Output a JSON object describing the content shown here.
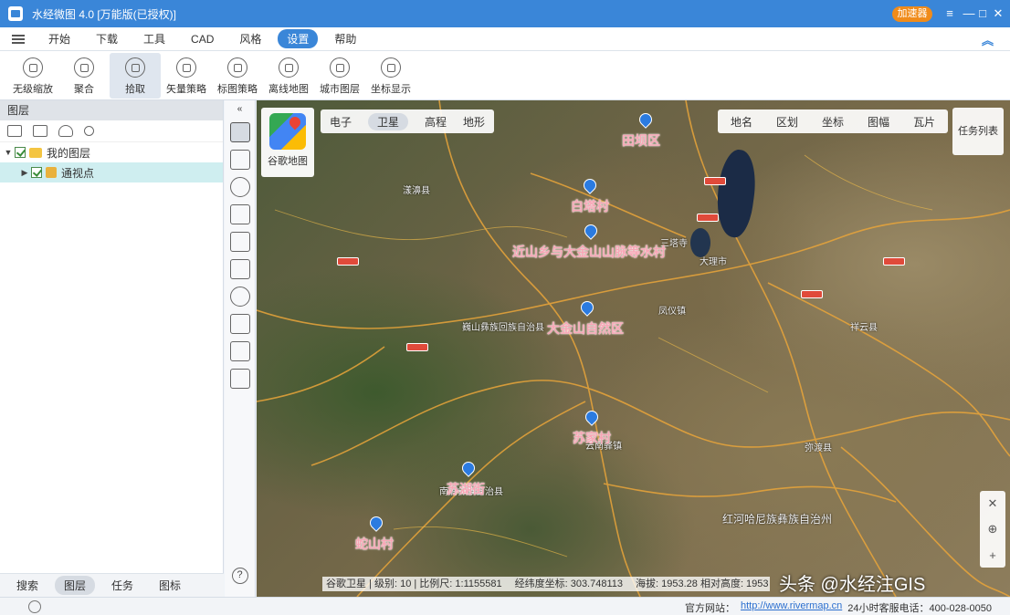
{
  "window": {
    "title": "水经微图 4.0 [万能版(已授权)]",
    "vip_label": "加速器",
    "controls": {
      "menu": "≡",
      "minimize": "—",
      "maximize": "□",
      "close": "✕"
    }
  },
  "menubar": {
    "items": [
      "开始",
      "下载",
      "工具",
      "CAD",
      "风格",
      "设置",
      "帮助"
    ],
    "active_index": 5,
    "collapse_glyph": "︽"
  },
  "toolbar": {
    "items": [
      {
        "label": "无级缩放"
      },
      {
        "label": "聚合"
      },
      {
        "label": "拾取"
      },
      {
        "label": "矢量策略"
      },
      {
        "label": "标图策略"
      },
      {
        "label": "离线地图"
      },
      {
        "label": "城市图层"
      },
      {
        "label": "坐标显示"
      }
    ],
    "active_index": 2
  },
  "left_panel": {
    "header": "图层",
    "tree": [
      {
        "label": "我的图层",
        "level": 0,
        "expanded": true
      },
      {
        "label": "通视点",
        "level": 1,
        "expanded": false
      }
    ],
    "bottom_tabs": [
      "搜索",
      "图层",
      "任务",
      "图标"
    ],
    "bottom_active_index": 1,
    "help_glyph": "?"
  },
  "map": {
    "basemap_tabs": [
      "电子",
      "卫星",
      "高程",
      "地形"
    ],
    "basemap_active_index": 1,
    "google_map_label": "谷歌地图",
    "tools": [
      "地名",
      "区划",
      "坐标",
      "图幅",
      "瓦片"
    ],
    "task_list_label": "任务列表",
    "pins": [
      {
        "label": "田坝区"
      },
      {
        "label": "白塔村"
      },
      {
        "label": "近山乡与大金山山脉等水村"
      },
      {
        "label": "大金山自然区"
      },
      {
        "label": "苏家村"
      },
      {
        "label": "苏湖街"
      },
      {
        "label": "蛇山村"
      }
    ],
    "place_labels": [
      "三塔寺",
      "大理市",
      "弥渡县",
      "祥云县",
      "巍山彝族回族自治县",
      "南涧彝族自治县",
      "凤仪镇",
      "漾濞县",
      "云南驿镇",
      "红河哈尼族彝族自治州"
    ],
    "coordinate_readout": {
      "source": "谷歌卫星 | 级别: 10 | 比例尺: 1:1155581",
      "position": "经纬度坐标: 303.748113",
      "altitude": "海拔: 1953.28  相对高度: 1953"
    },
    "watermark": "头条 @水经注GIS",
    "zoom_controls": [
      "✕",
      "⊕",
      "+"
    ]
  },
  "statusbar": {
    "site_label": "官方网站：",
    "site_link": "http://www.rivermap.cn",
    "hotline": "24小时客服电话：400-028-0050"
  },
  "colors": {
    "titlebar": "#3a86d8",
    "accent": "#3a86d8",
    "vip": "#f08b1a",
    "pin": "#2b7be0",
    "pin_label": "#f7a7b6"
  }
}
